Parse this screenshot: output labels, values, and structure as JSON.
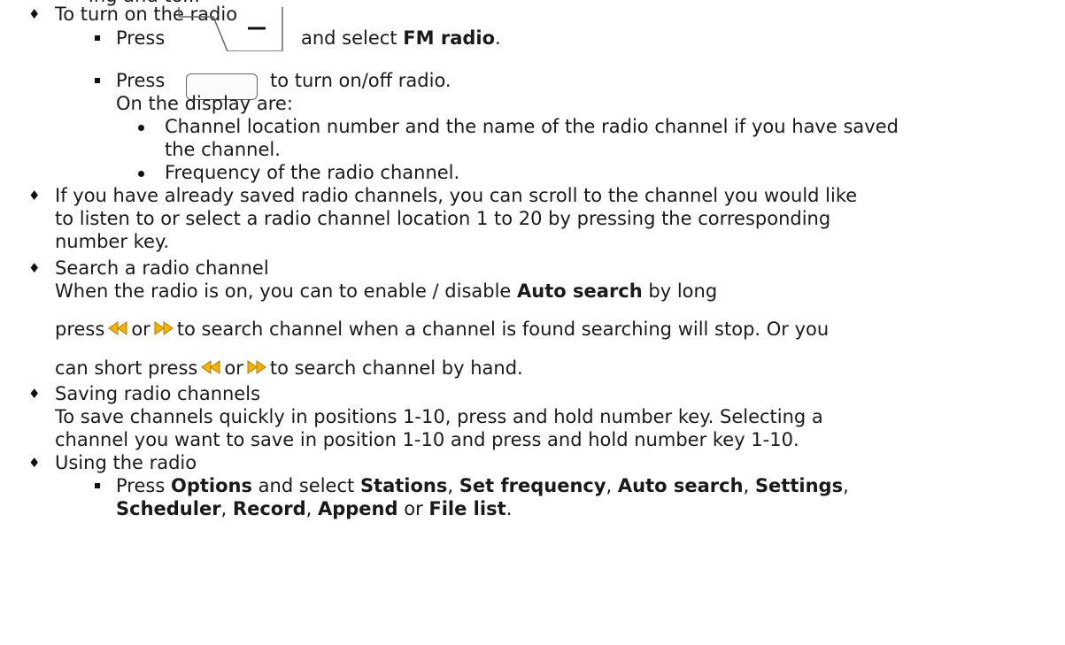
{
  "top_cut": "ing and to...",
  "s1": {
    "title": "To turn on the radio",
    "a_pre": "Press",
    "a_post": "and select",
    "a_bold": "FM radio",
    "a_end": ".",
    "b_pre": "Press",
    "b_post": "to turn on/off radio.",
    "display_intro": "On the display are:",
    "d1_l1": "Channel location number and the name of the radio channel if you have saved",
    "d1_l2": "the channel.",
    "d2": "Frequency of the radio channel."
  },
  "s2": {
    "l1": "If you have already saved radio channels, you can scroll to the channel you would like",
    "l2": "to listen to or select a radio channel location 1 to 20 by pressing the corresponding",
    "l3": "number key."
  },
  "s3": {
    "title": "Search a radio channel",
    "l1_pre": "When the radio is on, you can to enable / disable",
    "l1_bold": "Auto search",
    "l1_post": "by long",
    "l2_pre": "press",
    "or": "or",
    "l2_post": "to search channel when a channel is found searching will stop. Or you",
    "l3_pre": "can short press",
    "l3_post": "to search channel by hand."
  },
  "s4": {
    "title": "Saving radio channels",
    "l1": "To save channels quickly in positions 1-10, press and hold number key. Selecting a",
    "l2": "channel you want to save in position 1-10 and press and hold number key 1-10."
  },
  "s5": {
    "title": "Using the radio",
    "pre": "Press",
    "options": "Options",
    "and_select": "and select",
    "stations": "Stations",
    "set_frequency": "Set frequency",
    "auto_search": "Auto search",
    "settings": "Settings",
    "scheduler": "Scheduler",
    "record": "Record",
    "append": "Append",
    "or": "or",
    "file_list": "File list",
    "comma": ",",
    "end": "."
  },
  "colors": {
    "arrow_fill": "#f2b400",
    "arrow_stroke": "#b07800",
    "text": "#1a1a1a"
  },
  "icons": [
    "left-soft-key-icon",
    "round-key-icon",
    "rewind-icon",
    "fast-forward-icon"
  ]
}
